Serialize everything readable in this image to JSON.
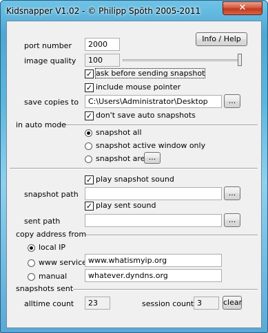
{
  "window": {
    "title": "Kidsnapper V1.02 - © Philipp Spöth 2005-2011",
    "close_glyph": "✕"
  },
  "info_button": "Info / Help",
  "port": {
    "label": "port number",
    "value": "2000"
  },
  "quality": {
    "label": "image quality",
    "value": "100",
    "slider_percent": 100
  },
  "options": {
    "ask_before": "ask before sending snapshot",
    "include_pointer": "include mouse pointer"
  },
  "save_copies": {
    "label": "save copies to",
    "value": "C:\\Users\\Administrator\\Desktop",
    "browse": "..."
  },
  "dont_save_auto": "don't save auto snapshots",
  "auto_mode": {
    "label": "in auto mode",
    "snapshot_all": "snapshot all",
    "snapshot_active": "snapshot active window only",
    "snapshot_area": "snapshot area",
    "area_btn": "..."
  },
  "sound": {
    "play_snapshot": "play snapshot sound",
    "snapshot_path_label": "snapshot path",
    "snapshot_path_value": "",
    "snapshot_browse": "...",
    "play_sent": "play sent sound",
    "sent_path_label": "sent path",
    "sent_path_value": "",
    "sent_browse": "..."
  },
  "copy_address": {
    "label": "copy address from",
    "local_ip": "local IP",
    "www_service": "www service",
    "www_value": "www.whatismyip.org",
    "manual": "manual",
    "manual_value": "whatever.dyndns.org"
  },
  "stats": {
    "label": "snapshots sent",
    "alltime_label": "alltime count",
    "alltime_value": "23",
    "session_label": "session count",
    "session_value": "3",
    "clear": "clear"
  }
}
